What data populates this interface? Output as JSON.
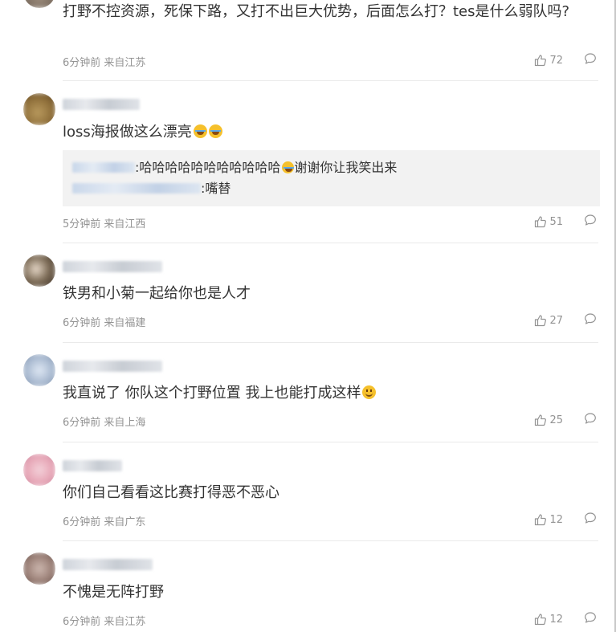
{
  "comments": [
    {
      "text": "打野不控资源，死保下路，又打不出巨大优势，后面怎么打？tes是什么弱队吗?",
      "time": "6分钟前",
      "location": "来自江苏",
      "likes": "72"
    },
    {
      "text": "loss海报做这么漂亮",
      "emoji": [
        "laugh-cry-emoji",
        "laugh-cry-emoji"
      ],
      "time": "5分钟前",
      "location": "来自江西",
      "likes": "51",
      "replies": [
        {
          "text": ":哈哈哈哈哈哈哈哈哈哈哈",
          "suffix": "谢谢你让我笑出来"
        },
        {
          "text": ":嘴替"
        }
      ]
    },
    {
      "text": "铁男和小菊一起给你也是人才",
      "time": "6分钟前",
      "location": "来自福建",
      "likes": "27"
    },
    {
      "text": "我直说了 你队这个打野位置 我上也能打成这样",
      "emoji": [
        "smile-emoji"
      ],
      "time": "6分钟前",
      "location": "来自上海",
      "likes": "25"
    },
    {
      "text": "你们自己看看这比赛打得恶不恶心",
      "time": "6分钟前",
      "location": "来自广东",
      "likes": "12"
    },
    {
      "text": "不愧是无阵打野",
      "time": "6分钟前",
      "location": "来自江苏",
      "likes": "12"
    }
  ],
  "icons": {
    "like": "thumbs-up-icon",
    "comment": "comment-bubble-icon"
  },
  "colors": {
    "text": "#333333",
    "meta": "#939393",
    "reply_bg": "#f2f2f2",
    "divider": "#eaeaea"
  }
}
